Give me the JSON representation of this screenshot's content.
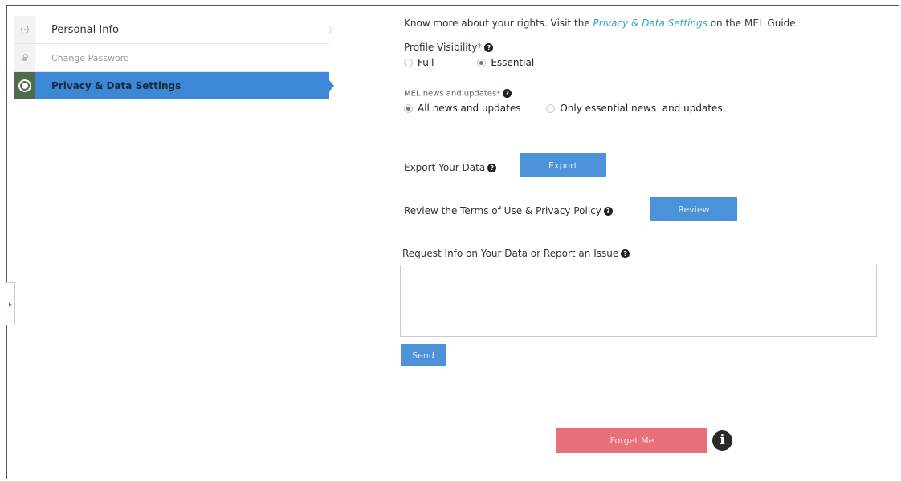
{
  "sidebar": {
    "items": [
      {
        "label": "Personal Info",
        "icon": "user-icon"
      },
      {
        "label": "Change Password",
        "icon": "lock-icon"
      },
      {
        "label": "Privacy & Data Settings",
        "icon": "gear-icon"
      }
    ],
    "active_color": "#3d88d6"
  },
  "main": {
    "intro_prefix": "Know more about your rights. Visit the ",
    "intro_link": "Privacy & Data Settings",
    "intro_suffix": " on the MEL Guide.",
    "profile_visibility": {
      "label": "Profile Visibility",
      "required_mark": "*",
      "options": [
        "Full",
        "Essential"
      ],
      "selected": "Essential"
    },
    "news": {
      "label": "MEL news and updates",
      "required_mark": "*",
      "options": [
        "All news and updates",
        "Only essential news  and updates"
      ],
      "selected": "All news and updates"
    },
    "export": {
      "label": "Export Your Data",
      "button": "Export"
    },
    "review": {
      "label": "Review the Terms of Use & Privacy Policy",
      "button": "Review"
    },
    "request": {
      "label": "Request Info on Your Data or Report an Issue",
      "value": ""
    },
    "send_button": "Send",
    "forget_button": "Forget Me",
    "help_glyph": "?",
    "info_glyph": "i"
  },
  "colors": {
    "primary_button": "#4b92d8",
    "danger_button": "#e8707a",
    "link": "#3aa0c8"
  }
}
